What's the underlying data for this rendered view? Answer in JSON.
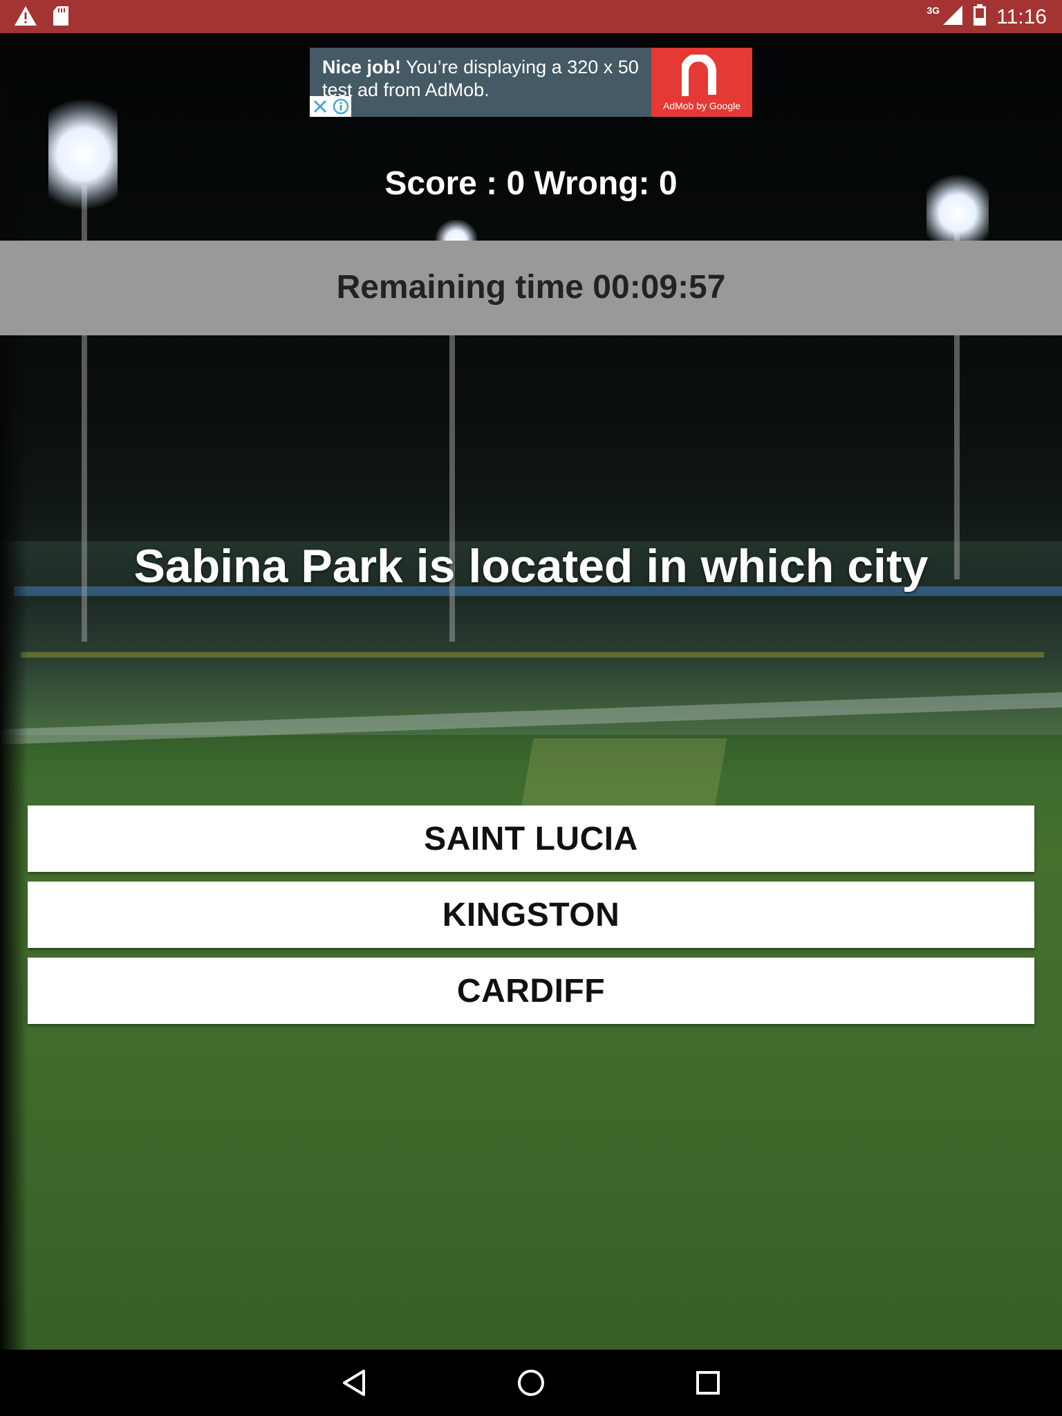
{
  "status_bar": {
    "time": "11:16",
    "network_label": "3G",
    "icons": [
      "warning-icon",
      "sd-card-icon",
      "signal-icon",
      "battery-icon"
    ]
  },
  "ad": {
    "headline": "Nice job!",
    "body": " You’re displaying a 320 x 50 test ad from AdMob.",
    "brand_caption": "AdMob by Google"
  },
  "score": {
    "text": "Score : 0 Wrong: 0"
  },
  "timer": {
    "text": "Remaining time 00:09:57"
  },
  "question": {
    "text": "Sabina Park is located in which city"
  },
  "answers": [
    "SAINT LUCIA",
    "KINGSTON",
    "CARDIFF"
  ],
  "colors": {
    "status_bar": "#a33431",
    "timer_band": "#999999",
    "ad_background": "#455a64",
    "ad_logo": "#e53935"
  }
}
